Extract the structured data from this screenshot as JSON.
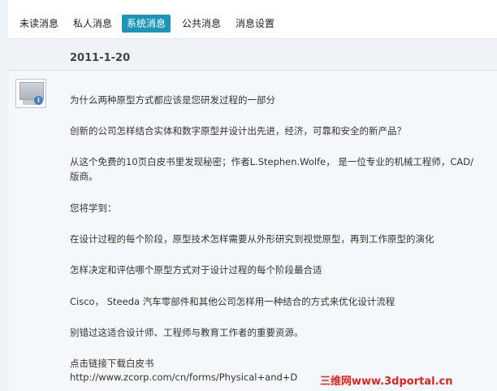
{
  "tabs": [
    {
      "label": "未读消息",
      "active": false
    },
    {
      "label": "私人消息",
      "active": false
    },
    {
      "label": "系统消息",
      "active": true
    },
    {
      "label": "公共消息",
      "active": false
    },
    {
      "label": "消息设置",
      "active": false
    }
  ],
  "message": {
    "date": "2011-1-20",
    "lines": [
      "为什么两种原型方式都应该是您研发过程的一部分",
      "创新的公司怎样结合实体和数字原型并设计出先进，经济，可靠和安全的新产品？",
      "从这个免费的10页白皮书里发现秘密；作者L.Stephen.Wolfe， 是一位专业的机械工程师，CAD/",
      "版商。",
      "您将学到：",
      "在设计过程的每个阶段，原型技术怎样需要从外形研究到视觉原型，再到工作原型的演化",
      "怎样决定和评估哪个原型方式对于设计过程的每个阶段最合适",
      "Cisco， Steeda 汽车零部件和其他公司怎样用一种结合的方式来优化设计流程",
      "别错过这适合设计师、工程师与教育工作者的重要资源。",
      "点击链接下载白皮书",
      "http://www.zcorp.com/cn/forms/Physical+and+D"
    ]
  },
  "watermark": "三维网www.3dportal.cn"
}
